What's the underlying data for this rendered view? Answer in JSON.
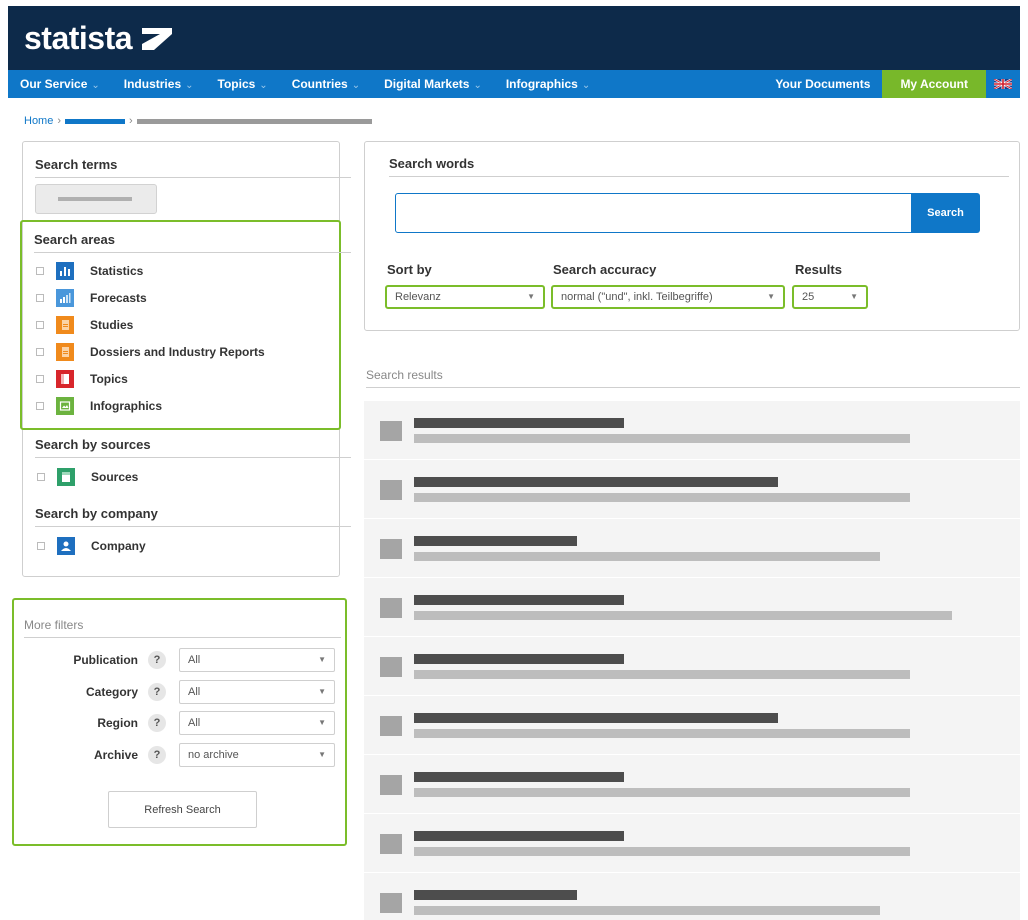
{
  "brand": {
    "name": "statista"
  },
  "nav": {
    "items": [
      {
        "label": "Our Service",
        "caret": "⌄"
      },
      {
        "label": "Industries",
        "caret": "⌄"
      },
      {
        "label": "Topics",
        "caret": "⌄"
      },
      {
        "label": "Countries",
        "caret": "⌄"
      },
      {
        "label": "Digital Markets",
        "caret": "⌄"
      },
      {
        "label": "Infographics",
        "caret": "⌄"
      }
    ],
    "documents": "Your Documents",
    "account": "My Account"
  },
  "breadcrumb": {
    "home": "Home",
    "sep": "›"
  },
  "left": {
    "search_terms_title": "Search terms",
    "search_areas_title": "Search areas",
    "areas": [
      {
        "label": "Statistics",
        "icon": "statistics-icon",
        "color": "#1e6fbf"
      },
      {
        "label": "Forecasts",
        "icon": "forecasts-icon",
        "color": "#4a97db"
      },
      {
        "label": "Studies",
        "icon": "studies-icon",
        "color": "#f08a1c"
      },
      {
        "label": "Dossiers and Industry Reports",
        "icon": "dossiers-icon",
        "color": "#f08a1c"
      },
      {
        "label": "Topics",
        "icon": "topics-icon",
        "color": "#d8262b"
      },
      {
        "label": "Infographics",
        "icon": "infographics-icon",
        "color": "#6cb33f"
      }
    ],
    "sources_title": "Search by sources",
    "sources": {
      "label": "Sources",
      "icon": "sources-icon",
      "color": "#2ea06a"
    },
    "company_title": "Search by company",
    "company": {
      "label": "Company",
      "icon": "company-icon",
      "color": "#1e6fbf"
    }
  },
  "filters": {
    "title": "More filters",
    "rows": [
      {
        "label": "Publication",
        "help": "?",
        "value": "All"
      },
      {
        "label": "Category",
        "help": "?",
        "value": "All"
      },
      {
        "label": "Region",
        "help": "?",
        "value": "All"
      },
      {
        "label": "Archive",
        "help": "?",
        "value": "no archive"
      }
    ],
    "refresh": "Refresh Search"
  },
  "search": {
    "title": "Search words",
    "button": "Search",
    "sort_by_label": "Sort by",
    "sort_by_value": "Relevanz",
    "accuracy_label": "Search accuracy",
    "accuracy_value": "normal (\"und\", inkl. Teilbegriffe)",
    "results_label": "Results",
    "results_value": "25"
  },
  "results": {
    "title": "Search results"
  },
  "colors": {
    "header": "#0d2a4a",
    "nav": "#0f77c8",
    "account": "#78b82a",
    "highlight": "#7bbd2a"
  }
}
